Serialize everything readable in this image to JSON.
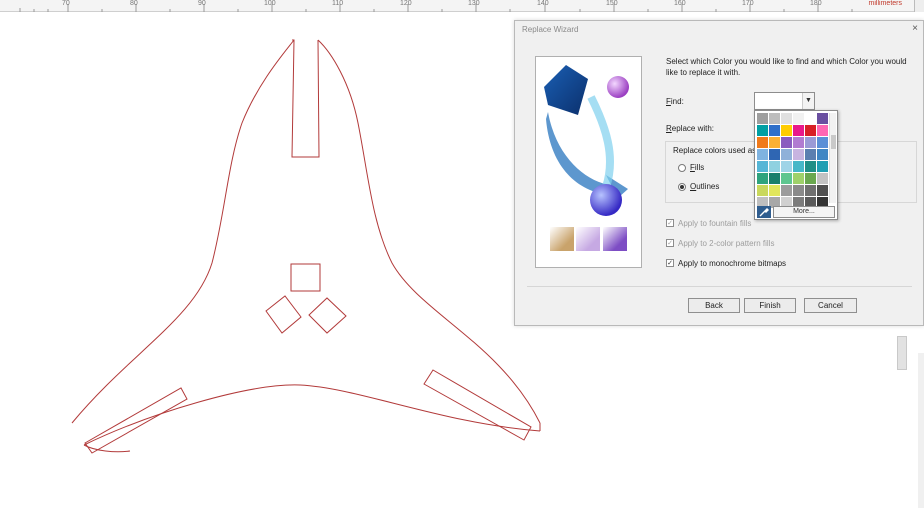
{
  "ruler": {
    "labels": [
      "70",
      "80",
      "90",
      "100",
      "110",
      "120",
      "130",
      "140",
      "150",
      "160",
      "170",
      "180"
    ],
    "unit": "millimeters"
  },
  "dialog": {
    "title": "Replace Wizard",
    "close": "×",
    "instruction": "Select which Color you would like to find and which Color you would like to replace it with.",
    "find_label_u": "F",
    "find_label_rest": "ind:",
    "replace_label_u": "R",
    "replace_label_rest": "eplace with:",
    "replace_colors_used_as": "Replace colors used as",
    "fills_u": "F",
    "fills_rest": "ills",
    "outlines_u": "O",
    "outlines_rest": "utlines",
    "selected_radio": "outlines",
    "apply_fountain": "Apply to fountain fills",
    "apply_two_color": "Apply to 2-color pattern fills",
    "apply_mono": "Apply to monochrome bitmaps",
    "apply_mono_checked": "✓",
    "apply_fountain_checked": "✓",
    "apply_two_color_checked": "✓",
    "back": "Back",
    "finish": "Finish",
    "cancel": "Cancel"
  },
  "palette": {
    "more": "More...",
    "colors": [
      "#9e9e9e",
      "#bdbdbd",
      "#e0e0e0",
      "#f1f1f1",
      "#ffffff",
      "#6a4fa0",
      "#009fa3",
      "#2e6fc9",
      "#ffcc00",
      "#e8198b",
      "#d81f26",
      "#ff66b3",
      "#f07a1a",
      "#fbb034",
      "#8a5cbf",
      "#b17bd1",
      "#9a9ad6",
      "#5a8fd6",
      "#7fb3e0",
      "#2f66b3",
      "#8fb1d9",
      "#c7b4e0",
      "#5b7fb0",
      "#3f86c4",
      "#55b6d6",
      "#8fd1e0",
      "#9fd4e7",
      "#46b8c8",
      "#1e8f86",
      "#1f9fb3",
      "#2fa37d",
      "#1a7f6b",
      "#5ec68f",
      "#9fd16a",
      "#6aa84f",
      "#c2c2c2",
      "#c9d85c",
      "#e1e65c",
      "#9c9c9c",
      "#8a8a8a",
      "#6f6f6f",
      "#4f4f4f",
      "#bfbfbf",
      "#a8a8a8",
      "#d0d0d0",
      "#7c7c7c",
      "#5a5a5a",
      "#333333"
    ]
  },
  "wizard_image": {
    "swatch_colors": [
      "#c9a36b",
      "#c6a9e3",
      "#7d4dc4"
    ]
  }
}
